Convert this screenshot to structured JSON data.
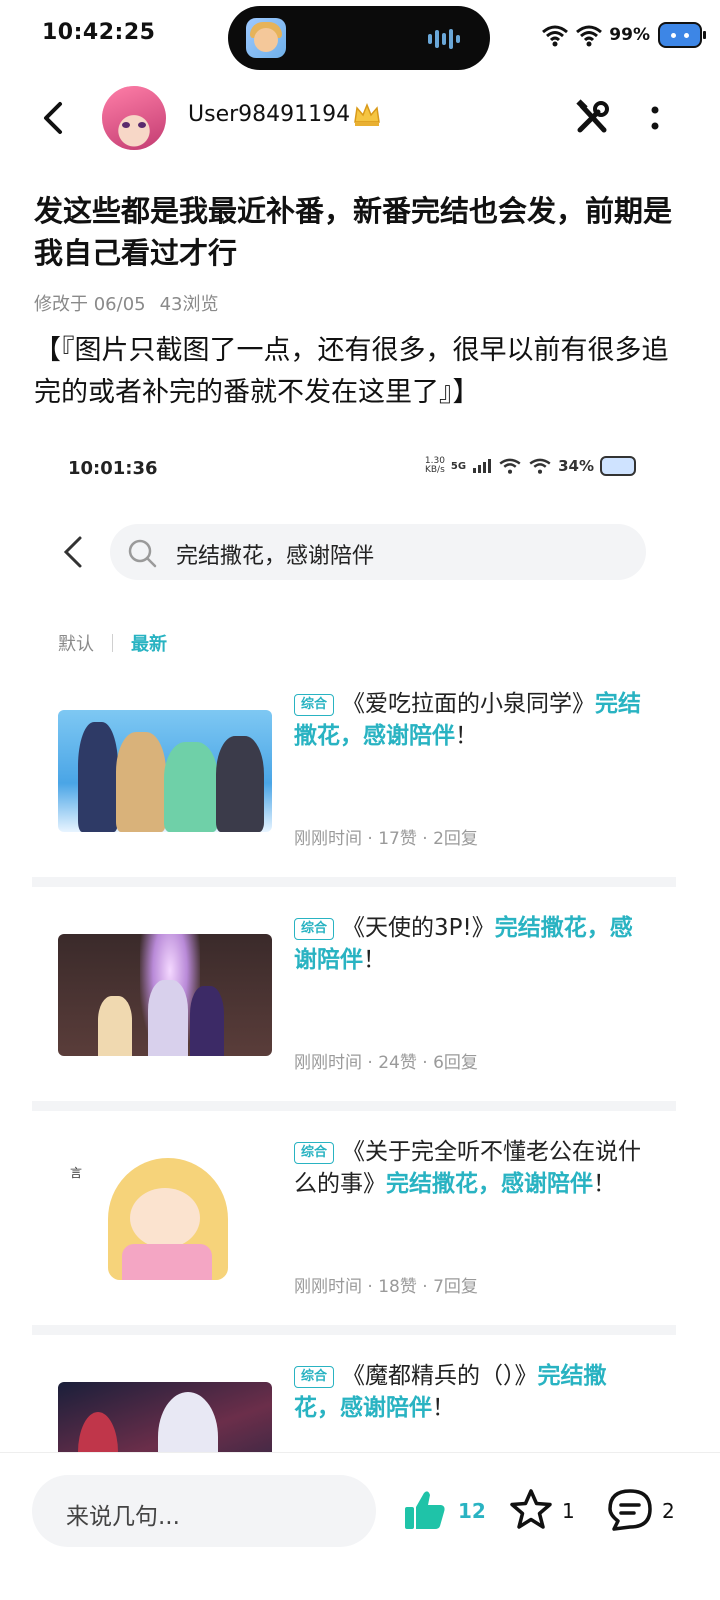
{
  "status_bar": {
    "time": "10:42:25",
    "battery": "99%"
  },
  "header": {
    "username": "User98491194",
    "icons": [
      "back-icon",
      "avatar",
      "crown-icon",
      "tools-icon",
      "more-icon"
    ]
  },
  "post": {
    "title": "发这些都是我最近补番，新番完结也会发，前期是我自己看过才行",
    "modified": "修改于 06/05",
    "views": "43浏览",
    "body": "【『图片只截图了一点，还有很多，很早以前有很多追完的或者补完的番就不发在这里了』】"
  },
  "embedded_screenshot": {
    "status_time": "10:01:36",
    "net_speed_value": "1.30",
    "net_speed_unit": "KB/s",
    "network": "5G",
    "battery": "34%",
    "search_text": "完结撒花，感谢陪伴",
    "sort_default": "默认",
    "sort_latest": "最新",
    "items": [
      {
        "tag": "综合",
        "title_plain": "《爱吃拉面的小泉同学》",
        "title_highlight": "完结撒花，感谢陪伴",
        "title_end": "！",
        "time": "刚刚时间",
        "likes": "17赞",
        "replies": "2回复"
      },
      {
        "tag": "综合",
        "title_plain": "《天使的3P!》",
        "title_highlight": "完结撒花，感谢陪伴",
        "title_end": "！",
        "time": "刚刚时间",
        "likes": "24赞",
        "replies": "6回复"
      },
      {
        "tag": "综合",
        "title_plain": "《关于完全听不懂老公在说什么的事》",
        "title_highlight": "完结撒花，感谢陪伴",
        "title_end": "！",
        "time": "刚刚时间",
        "likes": "18赞",
        "replies": "7回复"
      },
      {
        "tag": "综合",
        "title_plain": "《魔都精兵的（）》",
        "title_highlight": "完结撒花，感谢陪伴",
        "title_end": "！",
        "time": "",
        "likes": "",
        "replies": ""
      }
    ]
  },
  "bottom_bar": {
    "comment_placeholder": "来说几句...",
    "like_count": "12",
    "favorite_count": "1",
    "comment_count": "2"
  },
  "colors": {
    "accent": "#29b3c2",
    "like": "#1fc3a8",
    "meta": "#8a8a8a"
  }
}
